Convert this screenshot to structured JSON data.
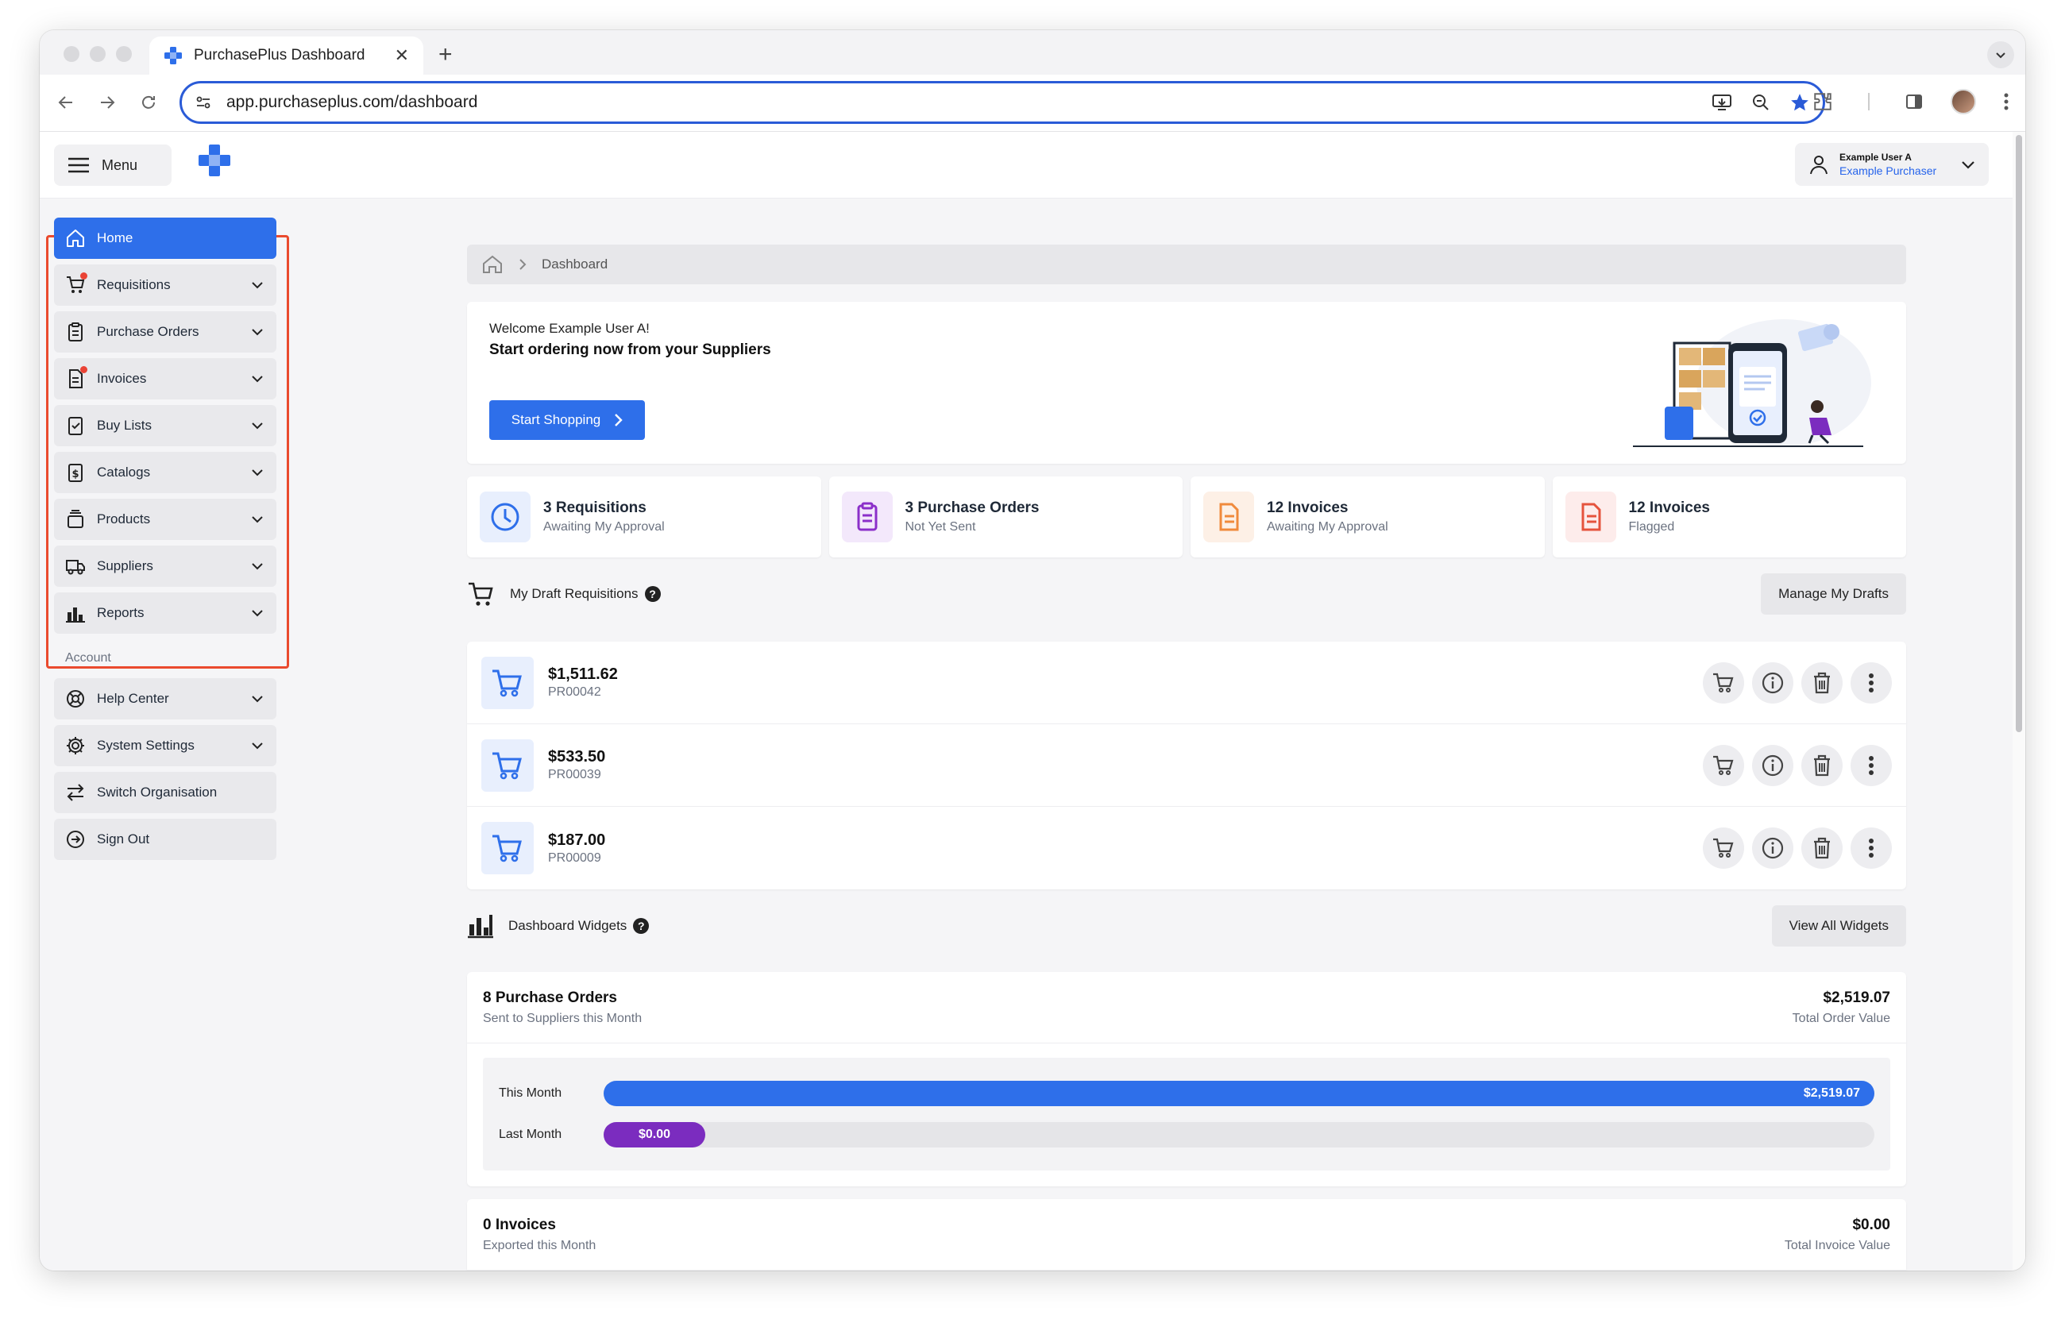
{
  "browser": {
    "tab_title": "PurchasePlus Dashboard",
    "url": "app.purchaseplus.com/dashboard"
  },
  "header": {
    "menu_label": "Menu",
    "user_name": "Example User A",
    "user_role": "Example Purchaser"
  },
  "sidebar": {
    "items": [
      {
        "label": "Home",
        "icon": "home-icon",
        "active": true
      },
      {
        "label": "Requisitions",
        "icon": "cart-icon",
        "badge": true
      },
      {
        "label": "Purchase Orders",
        "icon": "clipboard-icon"
      },
      {
        "label": "Invoices",
        "icon": "document-icon",
        "badge": true
      },
      {
        "label": "Buy Lists",
        "icon": "checklist-icon"
      },
      {
        "label": "Catalogs",
        "icon": "dollar-document-icon"
      },
      {
        "label": "Products",
        "icon": "box-icon"
      },
      {
        "label": "Suppliers",
        "icon": "truck-icon"
      },
      {
        "label": "Reports",
        "icon": "bar-chart-icon"
      }
    ],
    "account_label": "Account",
    "account_items": [
      {
        "label": "Help Center",
        "icon": "lifebuoy-icon"
      },
      {
        "label": "System Settings",
        "icon": "gear-icon"
      },
      {
        "label": "Switch Organisation",
        "icon": "switch-icon"
      },
      {
        "label": "Sign Out",
        "icon": "sign-out-icon"
      }
    ]
  },
  "breadcrumb": {
    "current": "Dashboard"
  },
  "welcome": {
    "greeting": "Welcome Example User A!",
    "headline": "Start ordering now from your Suppliers",
    "button_label": "Start Shopping"
  },
  "stats": [
    {
      "title": "3 Requisitions",
      "subtitle": "Awaiting My Approval",
      "icon": "clock-icon",
      "color": "#2e6fea",
      "bg": "#e8effd"
    },
    {
      "title": "3 Purchase Orders",
      "subtitle": "Not Yet Sent",
      "icon": "clipboard-icon",
      "color": "#8b2fc9",
      "bg": "#f3e8fb"
    },
    {
      "title": "12 Invoices",
      "subtitle": "Awaiting My Approval",
      "icon": "document-icon",
      "color": "#f08a3c",
      "bg": "#fdf0e6"
    },
    {
      "title": "12 Invoices",
      "subtitle": "Flagged",
      "icon": "document-icon",
      "color": "#e5533d",
      "bg": "#fdeceb"
    }
  ],
  "drafts": {
    "title": "My Draft Requisitions",
    "button_label": "Manage My Drafts",
    "rows": [
      {
        "amount": "$1,511.62",
        "ref": "PR00042"
      },
      {
        "amount": "$533.50",
        "ref": "PR00039"
      },
      {
        "amount": "$187.00",
        "ref": "PR00009"
      }
    ]
  },
  "widgets": {
    "title": "Dashboard Widgets",
    "button_label": "View All Widgets",
    "purchase_orders": {
      "title": "8 Purchase Orders",
      "subtitle": "Sent to Suppliers this Month",
      "value": "$2,519.07",
      "value_label": "Total Order Value",
      "bars": [
        {
          "label": "This Month",
          "value_text": "$2,519.07",
          "fraction": 1.0,
          "color": "#2e6fea"
        },
        {
          "label": "Last Month",
          "value_text": "$0.00",
          "fraction": 0.08,
          "color": "#7b2cbf"
        }
      ]
    },
    "invoices": {
      "title": "0 Invoices",
      "subtitle": "Exported this Month",
      "value": "$0.00",
      "value_label": "Total Invoice Value"
    }
  },
  "colors": {
    "accent": "#2e6fea",
    "highlight": "#ea4a2e",
    "badge": "#ea4335"
  }
}
